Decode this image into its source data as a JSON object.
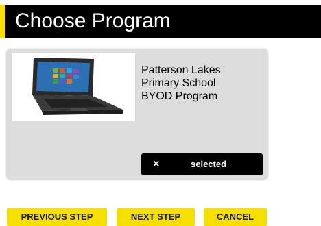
{
  "header": {
    "title": "Choose Program",
    "accent_color": "#f5df00"
  },
  "program_card": {
    "image": "laptop-image",
    "name_lines": [
      "Patterson Lakes",
      "Primary School",
      "BYOD Program"
    ],
    "deselect_icon": "×",
    "status_label": "selected"
  },
  "footer": {
    "previous_label": "PREVIOUS STEP",
    "next_label": "NEXT STEP",
    "cancel_label": "CANCEL"
  },
  "colors": {
    "button_bg": "#f5df00",
    "header_bg": "#000000",
    "card_bg": "#dcdcdc"
  }
}
